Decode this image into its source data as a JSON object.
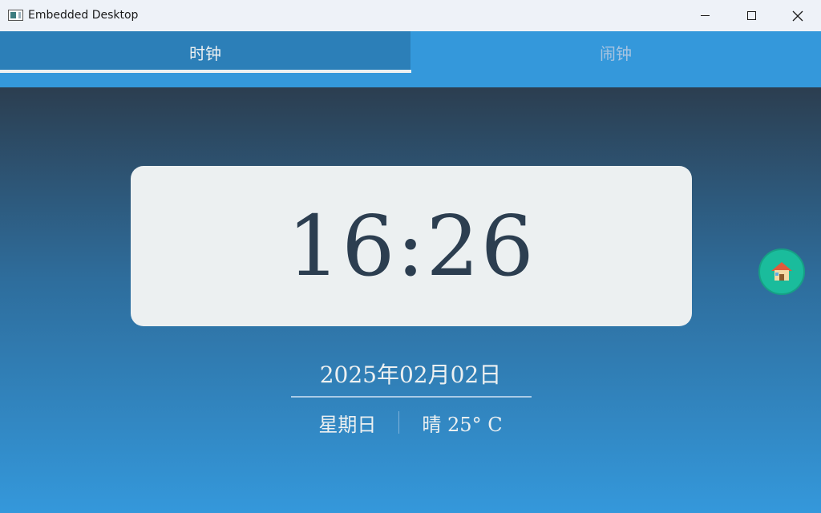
{
  "window": {
    "title": "Embedded Desktop"
  },
  "tabs": [
    {
      "label": "时钟",
      "active": true
    },
    {
      "label": "闹钟",
      "active": false
    }
  ],
  "clock": {
    "time": "16:26",
    "date": "2025年02月02日",
    "weekday": "星期日",
    "weather": "晴 25° C"
  },
  "home_button": {
    "icon": "home-icon"
  },
  "colors": {
    "tab_bar": "#3498db",
    "tab_active": "#2c7fb8",
    "card": "#ecf0f1",
    "clock_text": "#2c3e50",
    "home_button": "#1abc9c"
  }
}
